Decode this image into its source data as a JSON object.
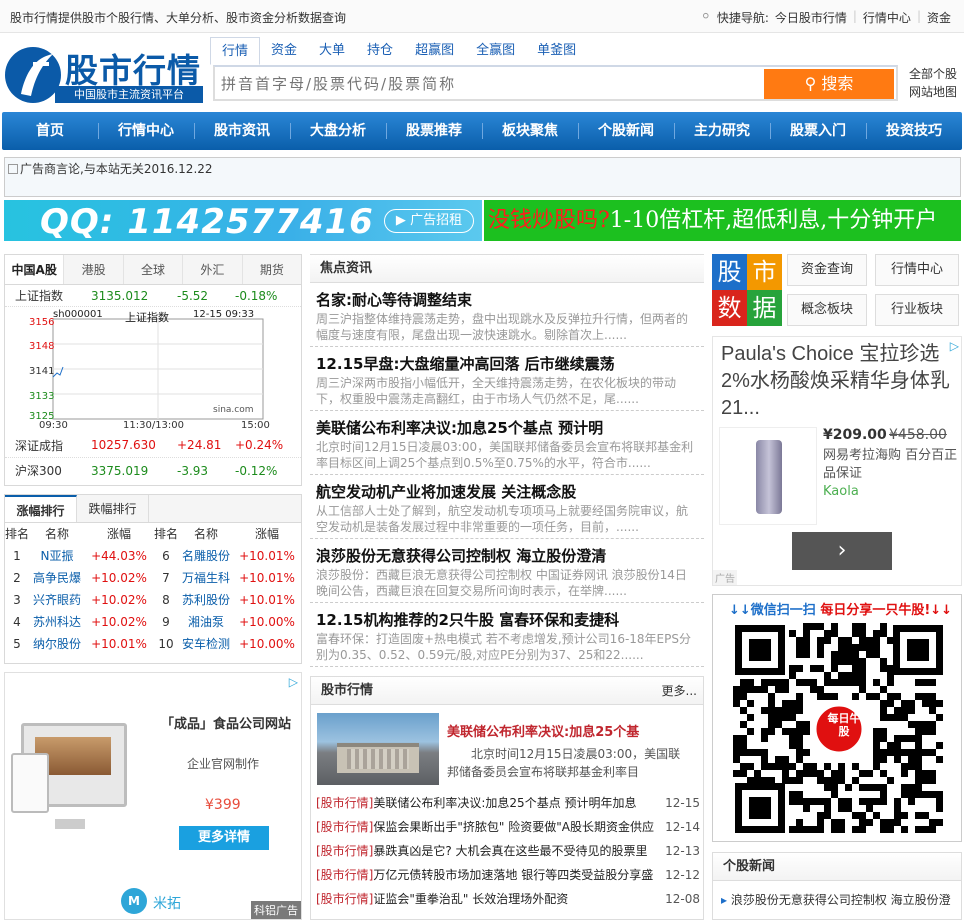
{
  "topbar": {
    "left_text": "股市行情提供股市个股行情、大单分析、股市资金分析数据查询",
    "quick_label": "快捷导航:",
    "links": [
      "今日股市行情",
      "行情中心",
      "资金"
    ]
  },
  "logo": {
    "title": "股市行情",
    "subtitle": "中国股市主流资讯平台"
  },
  "search": {
    "tabs": [
      "行情",
      "资金",
      "大单",
      "持仓",
      "超赢图",
      "全赢图",
      "单釜图"
    ],
    "placeholder": "拼音首字母/股票代码/股票简称",
    "button": "搜索",
    "right_links": [
      "全部个股",
      "网站地图"
    ]
  },
  "nav": [
    "首页",
    "行情中心",
    "股市资讯",
    "大盘分析",
    "股票推荐",
    "板块聚焦",
    "个股新闻",
    "主力研究",
    "股票入门",
    "投资技巧"
  ],
  "ads": {
    "notice": "广告商言论,与本站无关2016.12.22",
    "qq": "QQ: 1142577416",
    "qq_btn": "广告招租",
    "lever_a": "没钱炒股吗?",
    "lever_b": "1-10倍杠杆,超低利息,十分钟开户"
  },
  "market": {
    "tabs": [
      "中国A股",
      "港股",
      "全球",
      "外汇",
      "期货"
    ],
    "indices": [
      {
        "name": "上证指数",
        "value": "3135.012",
        "change": "-5.52",
        "pct": "-0.18%",
        "color": "#1c8b1c"
      },
      {
        "name": "深证成指",
        "value": "10257.630",
        "change": "+24.81",
        "pct": "+0.24%",
        "color": "#e01010"
      },
      {
        "name": "沪深300",
        "value": "3375.019",
        "change": "-3.93",
        "pct": "-0.12%",
        "color": "#1c8b1c"
      }
    ],
    "mini_chart": {
      "code": "sh000001",
      "name": "上证指数",
      "time": "12-15 09:33",
      "y_ticks": [
        "3156",
        "3148",
        "3141",
        "3133",
        "3125"
      ],
      "x_ticks": [
        "09:30",
        "11:30/13:00",
        "15:00"
      ],
      "source": "sina.com"
    }
  },
  "ranking": {
    "tabs": [
      "涨幅排行",
      "跌幅排行"
    ],
    "headers": [
      "排名",
      "名称",
      "涨幅",
      "排名",
      "名称",
      "涨幅"
    ],
    "rows": [
      [
        "1",
        "N亚振",
        "+44.03%",
        "6",
        "名雕股份",
        "+10.01%"
      ],
      [
        "2",
        "高争民爆",
        "+10.02%",
        "7",
        "万福生科",
        "+10.01%"
      ],
      [
        "3",
        "兴齐眼药",
        "+10.02%",
        "8",
        "苏利股份",
        "+10.01%"
      ],
      [
        "4",
        "苏州科达",
        "+10.02%",
        "9",
        "湘油泵",
        "+10.00%"
      ],
      [
        "5",
        "纳尔股份",
        "+10.01%",
        "10",
        "安车检测",
        "+10.00%"
      ]
    ]
  },
  "left_ad": {
    "title": "「成品」食品公司网站",
    "sub": "企业官网制作",
    "price": "¥399",
    "btn": "更多详情",
    "brand": "米拓",
    "foot": "科铝广告"
  },
  "focus": {
    "title": "焦点资讯",
    "items": [
      {
        "t": "名家:耐心等待调整结束",
        "d": "周三沪指整体维持震荡走势，盘中出现跳水及反弹拉升行情，但两者的幅度与速度有限，尾盘出现一波快速跳水。剔除首次上......"
      },
      {
        "t": "12.15早盘:大盘缩量冲高回落 后市继续震荡",
        "d": "周三沪深两市股指小幅低开，全天维持震荡走势，在农化板块的带动下，权重股中震荡走高翻红，由于市场人气仍然不足，尾......"
      },
      {
        "t": "美联储公布利率决议:加息25个基点 预计明",
        "d": "北京时间12月15日凌晨03:00，美国联邦储备委员会宣布将联邦基金利率目标区间上调25个基点到0.5%至0.75%的水平，符合市......"
      },
      {
        "t": "航空发动机产业将加速发展 关注概念股",
        "d": "从工信部人士处了解到，航空发动机专项项马上就要经国务院审议，航空发动机是装备发展过程中非常重要的一项任务，目前，......"
      },
      {
        "t": "浪莎股份无意获得公司控制权 海立股份澄清",
        "d": "浪莎股份：西藏巨浪无意获得公司控制权 中国证券网讯 浪莎股份14日晚间公告，西藏巨浪在回复交易所问询时表示，在举牌......"
      },
      {
        "t": "12.15机构推荐的2只牛股 富春环保和麦捷科",
        "d": "富春环保：打造固废+热电模式 若不考虑增发,预计公司16-18年EPS分别为0.35、0.52、0.59元/股,对应PE分别为37、25和22......"
      }
    ]
  },
  "market_news": {
    "title": "股市行情",
    "more": "更多...",
    "feature": {
      "t": "美联储公布利率决议:加息25个基",
      "d": "北京时间12月15日凌晨03:00，美国联邦储备委员会宣布将联邦基金利率目"
    },
    "tag": "[股市行情]",
    "list": [
      {
        "t": "美联储公布利率决议:加息25个基点 预计明年加息",
        "date": "12-15"
      },
      {
        "t": "保监会果断出手\"挤脓包\" 险资要做\"A股长期资金供应",
        "date": "12-14"
      },
      {
        "t": "暴跌真凶是它? 大机会真在这些最不受待见的股票里",
        "date": "12-13"
      },
      {
        "t": "万亿元债转股市场加速落地 银行等四类受益股分享盛",
        "date": "12-12"
      },
      {
        "t": "证监会\"重拳治乱\" 长效治理场外配资",
        "date": "12-08"
      }
    ]
  },
  "right": {
    "tiles": [
      "股",
      "市",
      "数",
      "据"
    ],
    "btns": [
      "资金查询",
      "行情中心",
      "概念板块",
      "行业板块"
    ],
    "ad": {
      "title": "Paula's Choice 宝拉珍选 2%水杨酸焕采精华身体乳 21...",
      "price": "¥209.00",
      "old_price": "¥458.00",
      "desc": "网易考拉海购 百分百正品保证",
      "brand": "Kaola",
      "tag": "广告"
    },
    "qr": {
      "title_a": "↓↓微信扫一扫",
      "title_b": "每日分享一只牛股!↓↓",
      "center": "每日牛股"
    },
    "stock_news": {
      "title": "个股新闻",
      "first": "浪莎股份无意获得公司控制权 海立股份澄"
    }
  }
}
